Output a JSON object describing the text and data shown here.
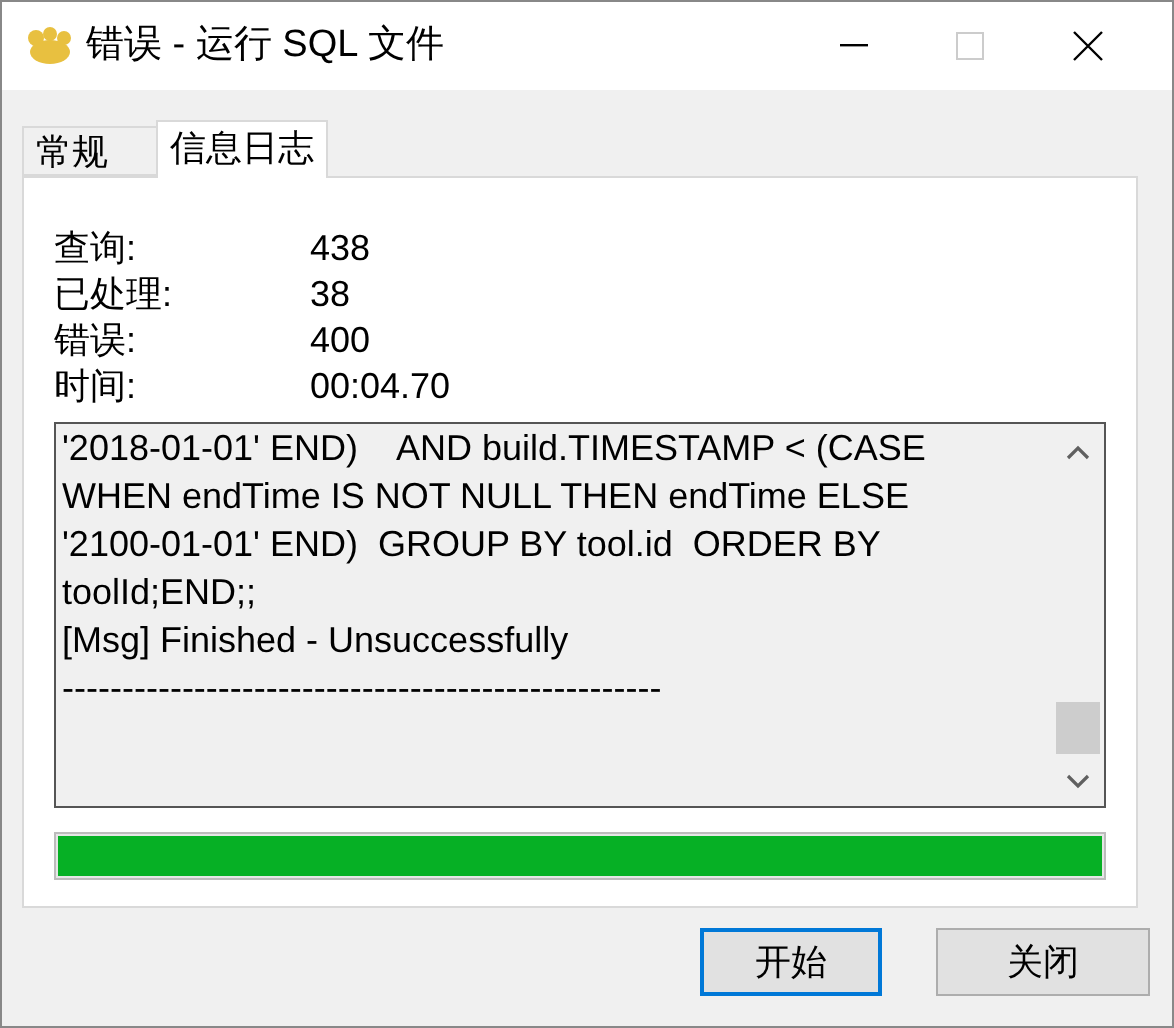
{
  "window": {
    "title": "错误 - 运行 SQL 文件"
  },
  "tabs": [
    {
      "label": "常规",
      "selected": false
    },
    {
      "label": "信息日志",
      "selected": true
    }
  ],
  "stats": [
    {
      "label": "查询:",
      "value": "438"
    },
    {
      "label": "已处理:",
      "value": "38"
    },
    {
      "label": "错误:",
      "value": "400"
    },
    {
      "label": "时间:",
      "value": "00:04.70"
    }
  ],
  "log": [
    "'2018-01-01' END)    AND build.TIMESTAMP < (CASE",
    "WHEN endTime IS NOT NULL THEN endTime ELSE",
    "'2100-01-01' END)  GROUP BY tool.id  ORDER BY",
    "toolId;END;;",
    "[Msg] Finished - Unsuccessfully",
    "--------------------------------------------------"
  ],
  "progress": {
    "level": 1
  },
  "buttons": [
    {
      "label": "开始",
      "selected": true
    },
    {
      "label": "关闭",
      "selected": false
    }
  ]
}
